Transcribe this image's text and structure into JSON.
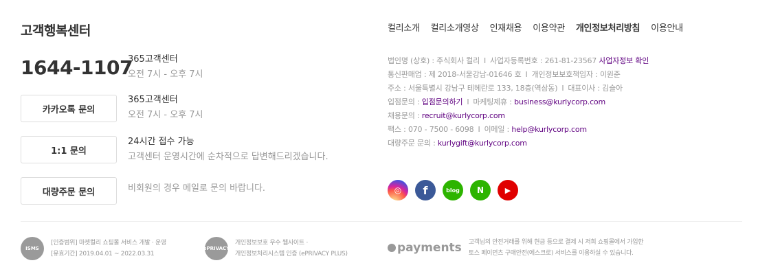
{
  "customer_center": {
    "title": "고객행복센터",
    "phone": "1644-1107",
    "phone_info": {
      "main": "365고객센터",
      "sub": "오전 7시 - 오후 7시"
    },
    "kakao": {
      "button": "카카오톡 문의",
      "main": "365고객센터",
      "sub": "오전 7시 - 오후 7시"
    },
    "one_to_one": {
      "button": "1:1 문의",
      "main": "24시간 접수 가능",
      "sub": "고객센터 운영시간에 순차적으로 답변해드리겠습니다."
    },
    "bulk": {
      "button": "대량주문 문의",
      "sub": "비회원의 경우 메일로 문의 바랍니다."
    }
  },
  "nav": [
    {
      "label": "컬리소개"
    },
    {
      "label": "컬리소개영상"
    },
    {
      "label": "인재채용"
    },
    {
      "label": "이용약관"
    },
    {
      "label": "개인정보처리방침"
    },
    {
      "label": "이용안내"
    }
  ],
  "company": {
    "line1_a": "법인명 (상호) : 주식회사 컬리",
    "line1_b": "사업자등록번호 : 261-81-23567",
    "line1_link": "사업자정보 확인",
    "line2_a": "통신판매업 : 제 2018-서울강남-01646 호",
    "line2_b": "개인정보보호책임자 : 이원준",
    "line3_a": "주소 : 서울특별시 강남구 테헤란로 133, 18층(역삼동)",
    "line3_b": "대표이사 : 김슬아",
    "line4_label": "입점문의 :",
    "line4_link": "입점문의하기",
    "line4_b_label": "마케팅제휴 :",
    "line4_b_link": "business@kurlycorp.com",
    "line5_label": "채용문의 :",
    "line5_link": "recruit@kurlycorp.com",
    "line6_label": "팩스 : 070 - 7500 - 6098",
    "line6_b_label": "이메일 :",
    "line6_b_link": "help@kurlycorp.com",
    "line7_label": "대량주문 문의 :",
    "line7_link": "kurlygift@kurlycorp.com"
  },
  "sns": [
    {
      "name": "instagram",
      "color": "#c13584",
      "glyph": "◎"
    },
    {
      "name": "facebook",
      "color": "#3b5998",
      "glyph": "f"
    },
    {
      "name": "blog",
      "color": "#2db400",
      "glyph": "blog"
    },
    {
      "name": "naver-post",
      "color": "#2db400",
      "glyph": "N"
    },
    {
      "name": "youtube",
      "color": "#e00000",
      "glyph": "▶"
    }
  ],
  "certs": {
    "isms_logo": "ISMS",
    "isms_line1": "[인증범위] 마켓컬리 쇼핑몰 서비스 개발 · 운영",
    "isms_line2": "[유효기간] 2019.04.01 ~ 2022.03.31",
    "privacy_logo": "ePRIVACY",
    "privacy_line1": "개인정보보호 우수 웹사이트 ·",
    "privacy_line2": "개인정보처리시스템 인증 (ePRIVACY PLUS)",
    "payments_logo": "payments",
    "payments_line1": "고객님의 안전거래를 위해 현금 등으로 결제 시 저희 쇼핑몰에서 가입한",
    "payments_line2": "토스 페이먼츠 구매안전(에스크로) 서비스를 이용하실 수 있습니다."
  }
}
